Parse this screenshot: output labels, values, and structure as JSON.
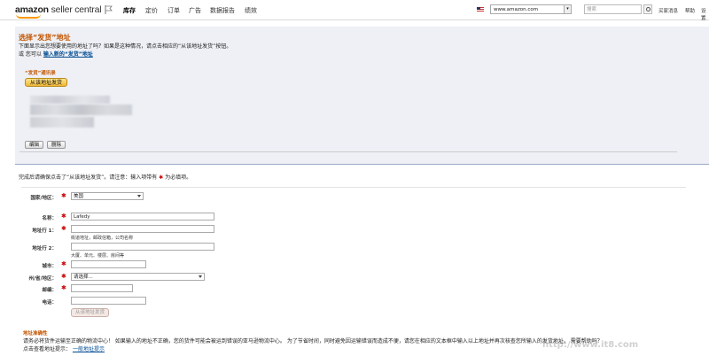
{
  "topbar": {
    "logo_brand": "amazon",
    "logo_product": "seller central",
    "nav": [
      "库存",
      "定价",
      "订单",
      "广告",
      "数据报告",
      "绩效"
    ],
    "marketplace": "www.amazon.com",
    "search_placeholder": "搜索",
    "links": [
      "买家消息",
      "帮助",
      "设置"
    ]
  },
  "page": {
    "title": "选择“发货”地址",
    "desc": "下面显示出您想要使用的地址了吗？如果是这种情况，请点击相应的“从该地址发货”按钮。",
    "or": "或 您可以",
    "new_address_link": "输入新的“发货”地址"
  },
  "card": {
    "label": "“发货”通讯录",
    "use_button": "从该地址发货",
    "edit_button": "编辑",
    "delete_button": "删除"
  },
  "form": {
    "note_pre": "完成后请确保点击了“从该地址发货”。请注意：输入项带有",
    "note_star": "✱",
    "note_post": "为必填项。",
    "star": "✱",
    "country_label": "国家/地区：",
    "country_value": "美国",
    "name_label": "名称：",
    "name_value": "Lafedy",
    "addr1_label": "地址行 1：",
    "addr1_hint": "街道地址，邮政信箱，公司名称",
    "addr2_label": "地址行 2：",
    "addr2_hint": "大厦、单元、楼层、房间等",
    "city_label": "城市：",
    "state_label": "州/省/地区：",
    "state_value": "请选择...",
    "zip_label": "邮编：",
    "phone_label": "电话：",
    "submit": "从该地址发货"
  },
  "warning": {
    "title": "地址准确性",
    "text": "请务必将货件运输至正确的物流中心！ 如果输入的地址不正确，您的货件可能会被运到错误的亚马逊物流中心。 为了节省时间，同时避免因运输错误而造成不便，请您在相应的文本框中输入以上地址并再次核查您所输入的发货地址。 需要帮助吗？",
    "link_pre": "点击查看地址提示：",
    "link": "一般地址提示"
  },
  "watermark": "http://www.it8.com"
}
